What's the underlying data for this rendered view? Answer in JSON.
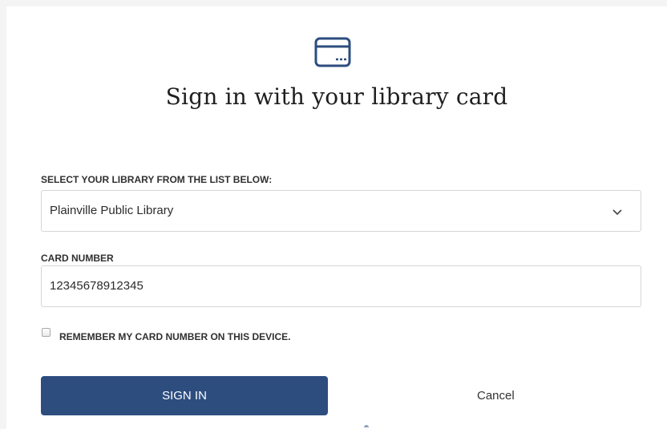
{
  "dialog": {
    "icon": "library-card-icon",
    "title": "Sign in with your library card"
  },
  "library_select": {
    "label": "SELECT YOUR LIBRARY FROM THE LIST BELOW:",
    "selected": "Plainville Public Library",
    "icon": "chevron-down-icon"
  },
  "card_number": {
    "label": "CARD NUMBER",
    "value": "12345678912345"
  },
  "remember": {
    "label": "REMEMBER MY CARD NUMBER ON THIS DEVICE.",
    "checked": false
  },
  "actions": {
    "sign_in_label": "SIGN IN",
    "cancel_label": "Cancel"
  },
  "colors": {
    "accent": "#2d4d7f",
    "border": "#d6d6d6",
    "text": "#303030"
  }
}
